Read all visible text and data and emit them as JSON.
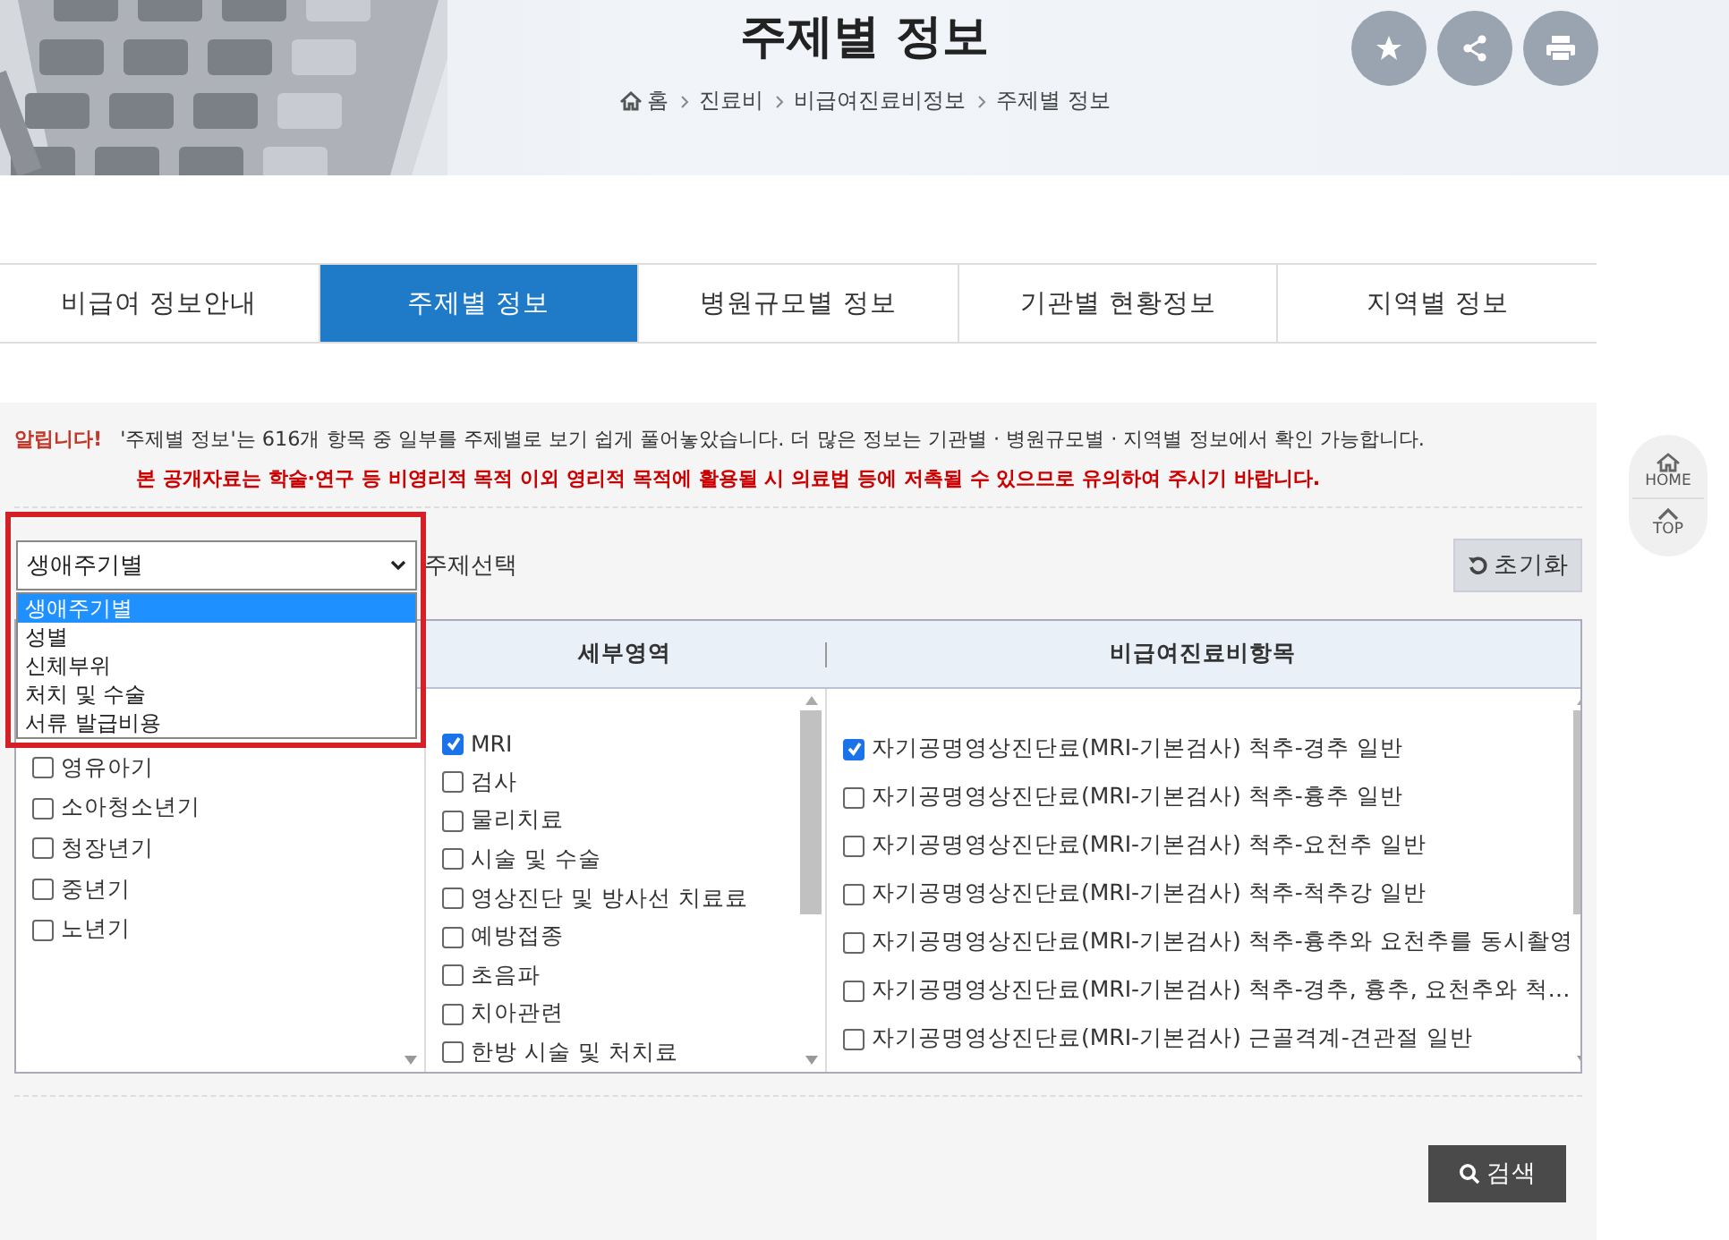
{
  "header": {
    "title": "주제별 정보",
    "breadcrumb": [
      "홈",
      "진료비",
      "비급여진료비정보",
      "주제별 정보"
    ]
  },
  "tabs": [
    {
      "label": "비급여 정보안내",
      "selected": false
    },
    {
      "label": "주제별 정보",
      "selected": true
    },
    {
      "label": "병원규모별 정보",
      "selected": false
    },
    {
      "label": "기관별 현황정보",
      "selected": false
    },
    {
      "label": "지역별 정보",
      "selected": false
    }
  ],
  "notice": {
    "label": "알립니다!",
    "text": "'주제별 정보'는 616개 항목 중 일부를 주제별로 보기 쉽게 풀어놓았습니다. 더 많은 정보는 기관별 · 병원규모별 · 지역별 정보에서 확인 가능합니다.",
    "warning": "본 공개자료는 학술·연구 등 비영리적 목적 이외 영리적 목적에 활용될 시 의료법 등에 저촉될 수 있으므로 유의하여 주시기 바랍니다."
  },
  "topic_select": {
    "value": "생애주기별",
    "label": "주제선택",
    "expanded": true,
    "options": [
      {
        "label": "생애주기별",
        "selected": true
      },
      {
        "label": "성별",
        "selected": false
      },
      {
        "label": "신체부위",
        "selected": false
      },
      {
        "label": "처치 및 수술",
        "selected": false
      },
      {
        "label": "서류 발급비용",
        "selected": false
      }
    ]
  },
  "reset_button": "초기화",
  "table": {
    "columns": [
      {
        "items": [
          {
            "label": "영유아기",
            "checked": false
          },
          {
            "label": "소아청소년기",
            "checked": false
          },
          {
            "label": "청장년기",
            "checked": false
          },
          {
            "label": "중년기",
            "checked": false
          },
          {
            "label": "노년기",
            "checked": false
          }
        ]
      },
      {
        "header": "세부영역",
        "items": [
          {
            "label": "MRI",
            "checked": true
          },
          {
            "label": "검사",
            "checked": false
          },
          {
            "label": "물리치료",
            "checked": false
          },
          {
            "label": "시술 및 수술",
            "checked": false
          },
          {
            "label": "영상진단 및 방사선 치료료",
            "checked": false
          },
          {
            "label": "예방접종",
            "checked": false
          },
          {
            "label": "초음파",
            "checked": false
          },
          {
            "label": "치아관련",
            "checked": false
          },
          {
            "label": "한방 시술 및 처치료",
            "checked": false
          }
        ]
      },
      {
        "header": "비급여진료비항목",
        "items": [
          {
            "label": "자기공명영상진단료(MRI-기본검사) 척추-경추 일반",
            "checked": true
          },
          {
            "label": "자기공명영상진단료(MRI-기본검사) 척추-흉추 일반",
            "checked": false
          },
          {
            "label": "자기공명영상진단료(MRI-기본검사) 척추-요천추 일반",
            "checked": false
          },
          {
            "label": "자기공명영상진단료(MRI-기본검사) 척추-척추강 일반",
            "checked": false
          },
          {
            "label": "자기공명영상진단료(MRI-기본검사) 척추-흉추와 요천추를 동시촬영",
            "checked": false
          },
          {
            "label": "자기공명영상진단료(MRI-기본검사) 척추-경추, 흉추, 요천추와 척…",
            "checked": false
          },
          {
            "label": "자기공명영상진단료(MRI-기본검사) 근골격계-견관절 일반",
            "checked": false
          }
        ]
      }
    ]
  },
  "search_button": "검색",
  "side_nav": [
    "HOME",
    "TOP"
  ]
}
